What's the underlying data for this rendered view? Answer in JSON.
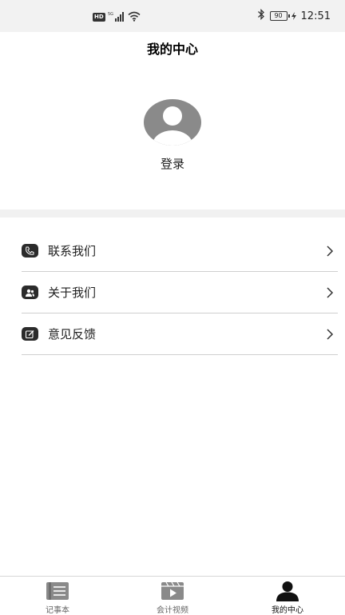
{
  "status_bar": {
    "network_badge": "HD",
    "network_type": "5G",
    "battery_level": "90",
    "time": "12:51"
  },
  "header": {
    "title": "我的中心"
  },
  "profile": {
    "login_label": "登录"
  },
  "menu": {
    "items": [
      {
        "label": "联系我们",
        "icon": "phone-icon"
      },
      {
        "label": "关于我们",
        "icon": "people-icon"
      },
      {
        "label": "意见反馈",
        "icon": "edit-icon"
      }
    ]
  },
  "bottom_nav": {
    "items": [
      {
        "label": "记事本",
        "icon": "notebook-icon",
        "active": false
      },
      {
        "label": "会计视频",
        "icon": "video-icon",
        "active": false
      },
      {
        "label": "我的中心",
        "icon": "user-icon",
        "active": true
      }
    ]
  },
  "colors": {
    "status_bar_bg": "#f2f2f2",
    "divider_band": "#f1f1f1",
    "icon_dark": "#2b2b2b",
    "inactive_nav": "#888888"
  }
}
